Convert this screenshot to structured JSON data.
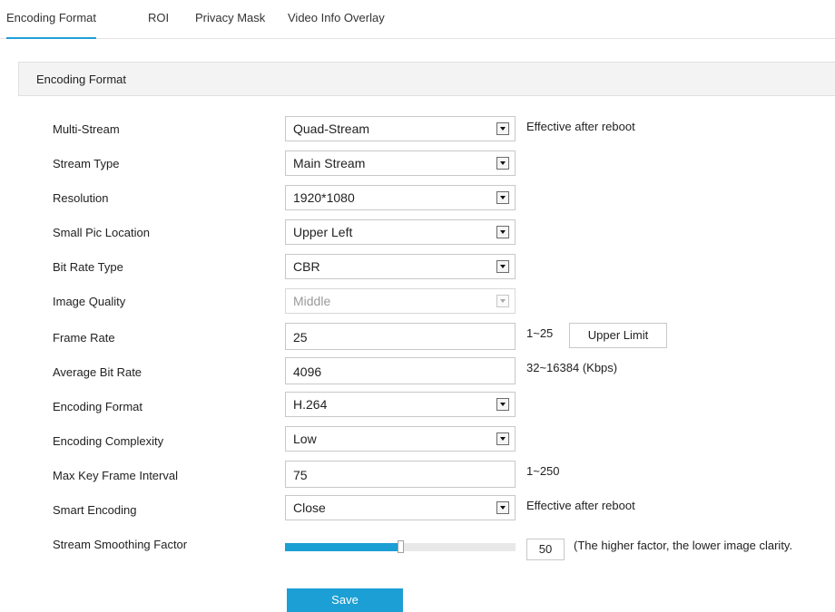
{
  "tabs": [
    {
      "label": "Encoding Format"
    },
    {
      "label": "ROI"
    },
    {
      "label": "Privacy Mask"
    },
    {
      "label": "Video Info Overlay"
    }
  ],
  "section_title": "Encoding Format",
  "fields": {
    "multi_stream": {
      "label": "Multi-Stream",
      "value": "Quad-Stream",
      "note": "Effective after reboot"
    },
    "stream_type": {
      "label": "Stream Type",
      "value": "Main Stream"
    },
    "resolution": {
      "label": "Resolution",
      "value": "1920*1080"
    },
    "small_pic_location": {
      "label": "Small Pic Location",
      "value": "Upper Left"
    },
    "bit_rate_type": {
      "label": "Bit Rate Type",
      "value": "CBR"
    },
    "image_quality": {
      "label": "Image Quality",
      "value": "Middle"
    },
    "frame_rate": {
      "label": "Frame Rate",
      "value": "25",
      "range": "1~25",
      "button": "Upper Limit"
    },
    "average_bit_rate": {
      "label": "Average Bit Rate",
      "value": "4096",
      "range": "32~16384 (Kbps)"
    },
    "encoding_format": {
      "label": "Encoding Format",
      "value": "H.264"
    },
    "encoding_complexity": {
      "label": "Encoding Complexity",
      "value": "Low"
    },
    "max_key_frame_interval": {
      "label": "Max Key Frame Interval",
      "value": "75",
      "range": "1~250"
    },
    "smart_encoding": {
      "label": "Smart Encoding",
      "value": "Close",
      "note": "Effective after reboot"
    },
    "stream_smoothing_factor": {
      "label": "Stream Smoothing Factor",
      "value": "50",
      "level": 0.5,
      "note": "(The higher factor, the lower image clarity."
    }
  },
  "save_label": "Save",
  "colors": {
    "accent": "#1c9fd4"
  }
}
